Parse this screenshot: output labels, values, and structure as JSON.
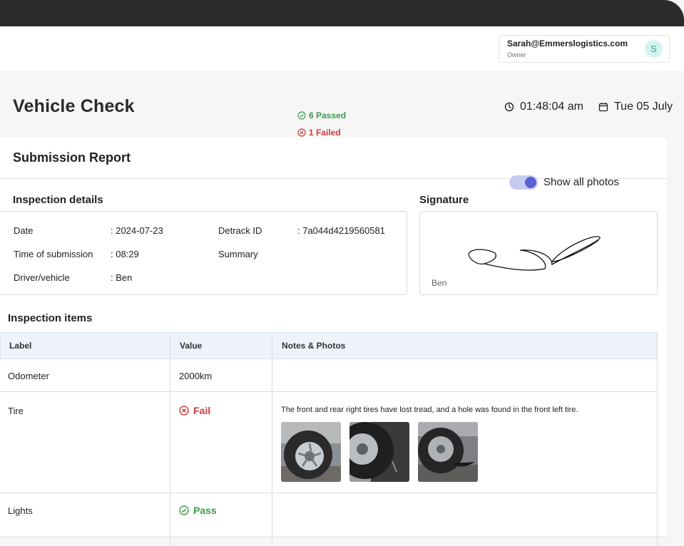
{
  "header": {
    "user_email": "Sarah@Emmerslogistics.com",
    "user_role": "Owner",
    "user_initial": "S"
  },
  "page": {
    "title": "Vehicle Check",
    "time": "01:48:04 am",
    "date": "Tue 05 July"
  },
  "report": {
    "title": "Submission Report",
    "details_heading": "Inspection details",
    "signature_heading": "Signature",
    "details": {
      "date_label": "Date",
      "date_value": ": 2024-07-23",
      "time_label": "Time of submission",
      "time_value": ": 08:29",
      "driver_label": "Driver/vehicle",
      "driver_value": ": Ben",
      "detrack_label": "Detrack ID",
      "detrack_value": ": 7a044d4219560581",
      "summary_label": "Summary",
      "summary_passed": "6 Passed",
      "summary_failed": "1 Failed"
    },
    "signature_name": "Ben"
  },
  "inspection": {
    "heading": "Inspection items",
    "toggle_label": "Show all photos",
    "toggle_on": true,
    "columns": [
      "Label",
      "Value",
      "Notes & Photos"
    ],
    "rows": [
      {
        "label": "Odometer",
        "value": "2000km",
        "note": ""
      },
      {
        "label": "Tire",
        "value": "Fail",
        "note": "The front and rear right tires have lost tread, and a hole was found in the front left tire."
      },
      {
        "label": "Lights",
        "value": "Pass",
        "note": ""
      }
    ]
  },
  "colors": {
    "pass": "#3b9b4a",
    "fail": "#d23a3a",
    "accent": "#5a5fd6"
  }
}
